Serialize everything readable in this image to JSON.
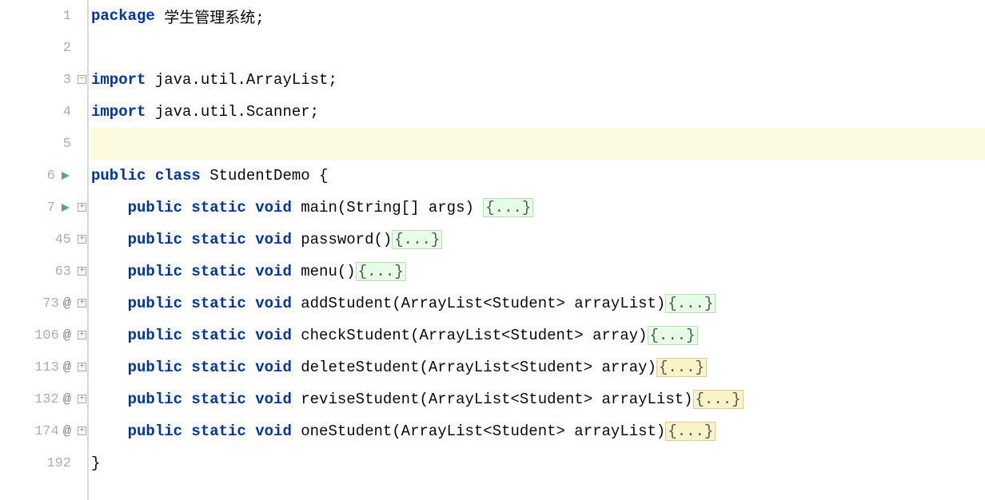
{
  "lines": [
    {
      "num": "1",
      "icons": [],
      "fold": "",
      "seg": [
        [
          "kw",
          "package "
        ],
        [
          "txt",
          "学生管理系统;"
        ]
      ]
    },
    {
      "num": "2",
      "icons": [],
      "fold": "",
      "seg": [
        [
          "txt",
          ""
        ]
      ]
    },
    {
      "num": "3",
      "icons": [],
      "fold": "minus",
      "seg": [
        [
          "kw",
          "import "
        ],
        [
          "txt",
          "java.util.ArrayList;"
        ]
      ]
    },
    {
      "num": "4",
      "icons": [],
      "fold": "end",
      "seg": [
        [
          "kw",
          "import "
        ],
        [
          "txt",
          "java.util.Scanner;"
        ]
      ]
    },
    {
      "num": "5",
      "icons": [],
      "fold": "",
      "seg": [
        [
          "txt",
          ""
        ]
      ],
      "highlight": true
    },
    {
      "num": "6",
      "icons": [
        "run"
      ],
      "fold": "",
      "seg": [
        [
          "kw",
          "public class "
        ],
        [
          "txt",
          "StudentDemo {"
        ]
      ]
    },
    {
      "num": "7",
      "icons": [
        "run",
        "plus"
      ],
      "fold": "plus",
      "seg": [
        [
          "txt",
          "    "
        ],
        [
          "kw",
          "public static void "
        ],
        [
          "txt",
          "main(String[] args) "
        ],
        [
          "fg",
          "{...}"
        ]
      ]
    },
    {
      "num": "45",
      "icons": [
        "plus"
      ],
      "fold": "plus",
      "seg": [
        [
          "txt",
          "    "
        ],
        [
          "kw",
          "public static void "
        ],
        [
          "txt",
          "password()"
        ],
        [
          "fg",
          "{...}"
        ]
      ]
    },
    {
      "num": "63",
      "icons": [
        "plus"
      ],
      "fold": "plus",
      "seg": [
        [
          "txt",
          "    "
        ],
        [
          "kw",
          "public static void "
        ],
        [
          "txt",
          "menu()"
        ],
        [
          "fg",
          "{...}"
        ]
      ]
    },
    {
      "num": "73",
      "icons": [
        "at",
        "plus"
      ],
      "fold": "plus",
      "seg": [
        [
          "txt",
          "    "
        ],
        [
          "kw",
          "public static void "
        ],
        [
          "txt",
          "addStudent(ArrayList<Student> arrayList)"
        ],
        [
          "fg",
          "{...}"
        ]
      ]
    },
    {
      "num": "106",
      "icons": [
        "at",
        "plus"
      ],
      "fold": "plus",
      "seg": [
        [
          "txt",
          "    "
        ],
        [
          "kw",
          "public static void "
        ],
        [
          "txt",
          "checkStudent(ArrayList<Student> array)"
        ],
        [
          "fg",
          "{...}"
        ]
      ]
    },
    {
      "num": "113",
      "icons": [
        "at",
        "plus"
      ],
      "fold": "plus",
      "seg": [
        [
          "txt",
          "    "
        ],
        [
          "kw",
          "public static void "
        ],
        [
          "txt",
          "deleteStudent(ArrayList<Student> array)"
        ],
        [
          "fy",
          "{...}"
        ]
      ]
    },
    {
      "num": "132",
      "icons": [
        "at",
        "plus"
      ],
      "fold": "plus",
      "seg": [
        [
          "txt",
          "    "
        ],
        [
          "kw",
          "public static void "
        ],
        [
          "txt",
          "reviseStudent(ArrayList<Student> arrayList)"
        ],
        [
          "fy",
          "{...}"
        ]
      ]
    },
    {
      "num": "174",
      "icons": [
        "at",
        "plus"
      ],
      "fold": "plus",
      "seg": [
        [
          "txt",
          "    "
        ],
        [
          "kw",
          "public static void "
        ],
        [
          "txt",
          "oneStudent(ArrayList<Student> arrayList)"
        ],
        [
          "fy",
          "{...}"
        ]
      ]
    },
    {
      "num": "192",
      "icons": [],
      "fold": "",
      "seg": [
        [
          "txt",
          "}"
        ]
      ]
    }
  ]
}
